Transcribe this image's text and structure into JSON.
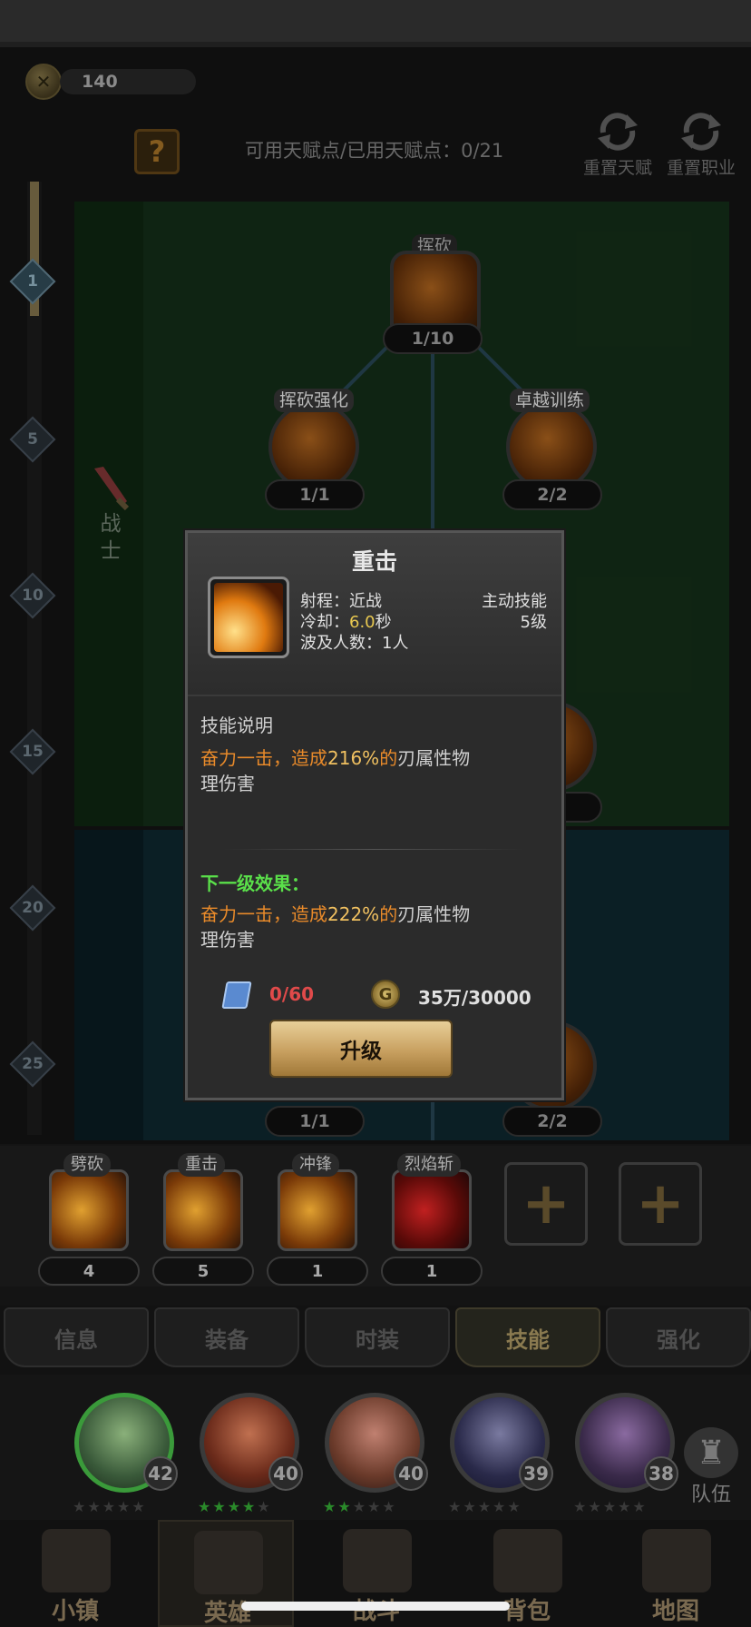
{
  "currency": {
    "amount": "140",
    "icon": "compass-coin-icon"
  },
  "header": {
    "help_label": "?",
    "talent_points_label": "可用天赋点/已用天赋点：",
    "talent_points_value": "0/21",
    "reset_talent_label": "重置天赋",
    "reset_class_label": "重置职业"
  },
  "levels": [
    "1",
    "5",
    "10",
    "15",
    "20",
    "25"
  ],
  "class_label": "战士",
  "tree": {
    "nodes": [
      {
        "name": "挥砍",
        "count": "1/10"
      },
      {
        "name": "挥砍强化",
        "count": "1/1"
      },
      {
        "name": "卓越训练",
        "count": "2/2"
      }
    ],
    "bottom_counts": [
      "1/1",
      "2/2"
    ]
  },
  "skill_bar": [
    {
      "name": "劈砍",
      "level": "4"
    },
    {
      "name": "重击",
      "level": "5"
    },
    {
      "name": "冲锋",
      "level": "1"
    },
    {
      "name": "烈焰斩",
      "level": "1"
    }
  ],
  "add_slot_symbol": "+",
  "tabs": [
    "信息",
    "装备",
    "时装",
    "技能",
    "强化"
  ],
  "active_tab": "技能",
  "heroes": [
    {
      "level": "42",
      "stars_lit": "",
      "stars_dim": "★★★★★"
    },
    {
      "level": "40",
      "stars_lit": "★★★★",
      "stars_dim": "★"
    },
    {
      "level": "40",
      "stars_lit": "★★",
      "stars_dim": "★★★"
    },
    {
      "level": "39",
      "stars_lit": "",
      "stars_dim": "★★★★★"
    },
    {
      "level": "38",
      "stars_lit": "",
      "stars_dim": "★★★★★"
    }
  ],
  "team_label": "队伍",
  "team_icon": "chess-icon",
  "nav": [
    "小镇",
    "英雄",
    "战斗",
    "背包",
    "地图"
  ],
  "popup": {
    "title": "重击",
    "range_label": "射程：",
    "range_value": "近战",
    "cooldown_label": "冷却：",
    "cooldown_value": "6.0",
    "cooldown_unit": "秒",
    "targets_label": "波及人数：",
    "targets_value": "1人",
    "skill_type": "主动技能",
    "skill_level": "5级",
    "desc_title": "技能说明",
    "desc_prefix": "奋力一击，造成",
    "desc_value": "216%",
    "desc_mid": "的",
    "desc_suffix": "刃属性物",
    "desc_line2": "理伤害",
    "next_title": "下一级效果：",
    "next_prefix": "奋力一击，造成",
    "next_value": "222%",
    "next_mid": "的",
    "next_suffix": "刃属性物",
    "next_line2": "理伤害",
    "book_count": "0/60",
    "gold_count": "35万/30000",
    "gold_symbol": "G",
    "upgrade_label": "升级"
  },
  "colors": {
    "accent_gold": "#c8a060",
    "highlight_orange": "#e88a2a",
    "next_green": "#5ae04a",
    "insufficient_red": "#e04a4a"
  }
}
